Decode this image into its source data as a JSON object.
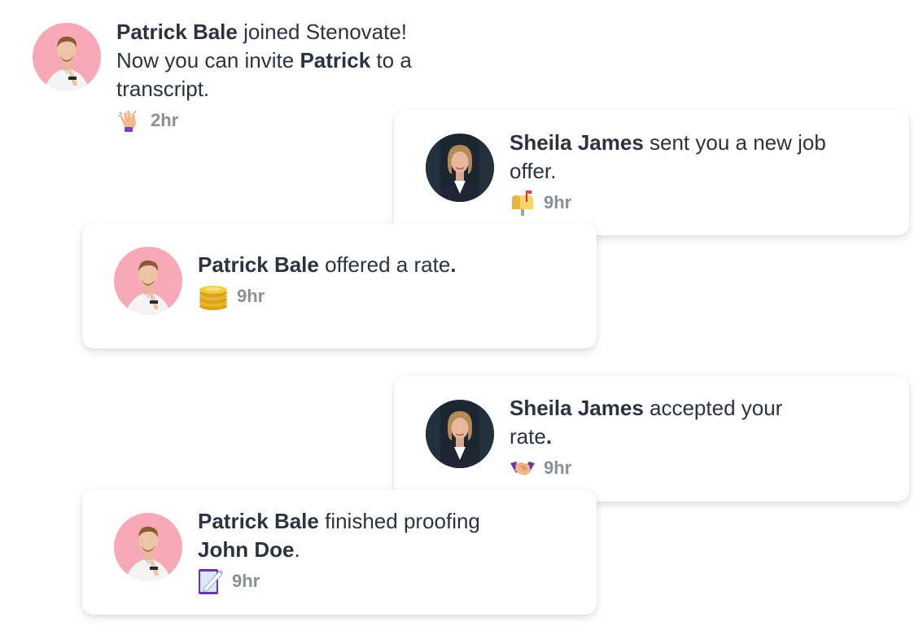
{
  "notifications": [
    {
      "actor": "Patrick Bale",
      "text_1": " joined Stenovate!",
      "text_2": "Now you can invite ",
      "bold_2": "Patrick",
      "text_3": " to a",
      "text_4": "transcript.",
      "time": "2hr",
      "icon": "waving-hand-icon"
    },
    {
      "actor": "Sheila James",
      "text_1": " sent you a new job",
      "text_2": "offer.",
      "time": "9hr",
      "icon": "mailbox-icon"
    },
    {
      "actor": "Patrick Bale",
      "text_1": " offered a rate",
      "text_2": ".",
      "time": "9hr",
      "icon": "coins-icon"
    },
    {
      "actor": "Sheila James",
      "text_1": " accepted your",
      "text_2": "rate",
      "text_3": ".",
      "time": "9hr",
      "icon": "handshake-icon"
    },
    {
      "actor": "Patrick Bale",
      "text_1": " finished proofing",
      "bold_2": "John Doe",
      "text_2": ".",
      "time": "9hr",
      "icon": "memo-icon"
    }
  ],
  "colors": {
    "text": "#2c3340",
    "time": "#8a8f98",
    "patrick_avatar_bg": "#f8a9b8",
    "sheila_avatar_bg": "#1b2630"
  }
}
